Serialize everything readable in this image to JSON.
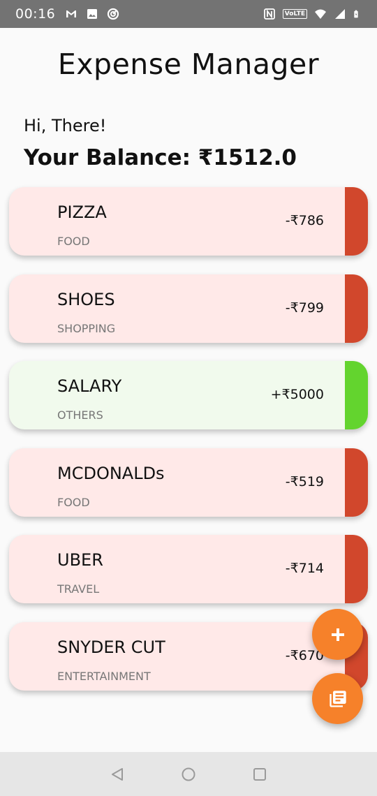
{
  "status_bar": {
    "time": "00:16",
    "volte_label": "VoLTE",
    "left_icons": [
      "gmail-icon",
      "image-icon",
      "sync-icon"
    ],
    "right_icons": [
      "nfc-icon",
      "volte-icon",
      "wifi-icon",
      "signal-icon",
      "battery-icon"
    ]
  },
  "header": {
    "title": "Expense Manager",
    "greeting": "Hi, There!",
    "balance": "Your Balance: ₹1512.0"
  },
  "colors": {
    "expense_bg": "#ffe9e8",
    "expense_stripe": "#d1472c",
    "income_bg": "#f1faed",
    "income_stripe": "#63d42e",
    "fab": "#f6812a"
  },
  "transactions": [
    {
      "name": "PIZZA",
      "category": "FOOD",
      "amount": "-₹786",
      "type": "expense"
    },
    {
      "name": "SHOES",
      "category": "SHOPPING",
      "amount": "-₹799",
      "type": "expense"
    },
    {
      "name": "SALARY",
      "category": "OTHERS",
      "amount": "+₹5000",
      "type": "income"
    },
    {
      "name": "MCDONALDs",
      "category": "FOOD",
      "amount": "-₹519",
      "type": "expense"
    },
    {
      "name": "UBER",
      "category": "TRAVEL",
      "amount": "-₹714",
      "type": "expense"
    },
    {
      "name": "SNYDER CUT",
      "category": "ENTERTAINMENT",
      "amount": "-₹670",
      "type": "expense"
    }
  ],
  "fabs": {
    "add_icon": "plus-icon",
    "list_icon": "library-books-icon"
  },
  "nav": {
    "buttons": [
      "back-icon",
      "home-icon",
      "recents-icon"
    ]
  }
}
